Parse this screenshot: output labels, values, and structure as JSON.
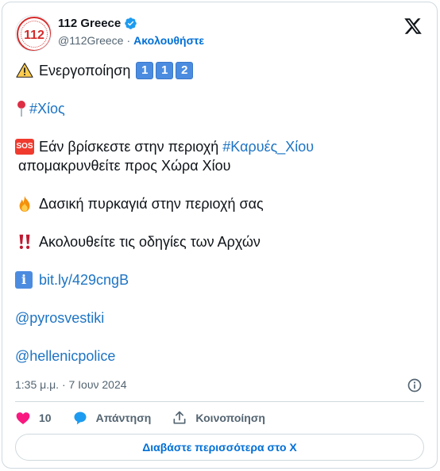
{
  "author": {
    "display_name": "112 Greece",
    "handle": "@112Greece",
    "separator": "·",
    "follow_label": "Ακολουθήστε"
  },
  "tweet": {
    "line1_text": "Ενεργοποίηση",
    "line1_keycaps": [
      "1",
      "1",
      "2"
    ],
    "line2_hashtag": "#Χίος",
    "line3_text": "Εάν βρίσκεστε στην περιοχή ",
    "line3_hashtag": "#Καρυές_Χίου",
    "line3_text2": "απομακρυνθείτε προς Χώρα Χίου",
    "sos_label": "SOS",
    "line4_text": "Δασική πυρκαγιά στην περιοχή σας",
    "line5_text": "Ακολουθείτε τις οδηγίες των Αρχών",
    "info_label": "i",
    "line6_link": "bit.ly/429cngB",
    "mention1": "@pyrosvestiki",
    "mention2": "@hellenicpolice"
  },
  "meta": {
    "timestamp": "1:35 μ.μ. · 7 Ιουν 2024"
  },
  "actions": {
    "like_count": "10",
    "reply_label": "Απάντηση",
    "share_label": "Κοινοποίηση"
  },
  "read_more_label": "Διαβάστε περισσότερα στο X",
  "colors": {
    "link": "#1d74c4",
    "follow": "#006fd6",
    "like": "#f91880",
    "reply": "#1d9bf0",
    "border": "#cfd9de"
  }
}
